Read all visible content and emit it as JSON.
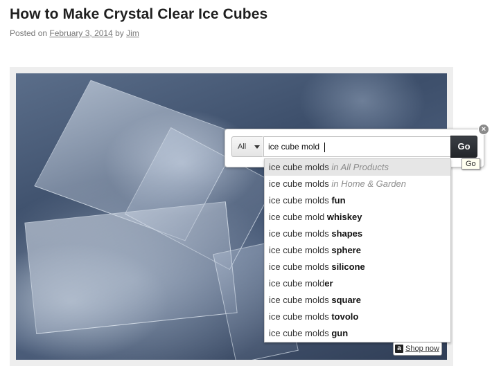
{
  "post": {
    "title": "How to Make Crystal Clear Ice Cubes",
    "posted_on_label": "Posted on",
    "date": "February 3, 2014",
    "by_label": "by",
    "author": "Jim"
  },
  "search": {
    "category": "All",
    "query": "ice cube mold",
    "go_label": "Go",
    "go_tooltip": "Go",
    "close_glyph": "×"
  },
  "suggestions": [
    {
      "prefix": "ice cube molds",
      "bold": "",
      "scope": "in All Products",
      "active": true
    },
    {
      "prefix": "ice cube molds",
      "bold": "",
      "scope": "in Home & Garden",
      "active": false
    },
    {
      "prefix": "ice cube molds",
      "bold": "fun",
      "scope": "",
      "active": false
    },
    {
      "prefix": "ice cube mold",
      "bold": "whiskey",
      "scope": "",
      "active": false
    },
    {
      "prefix": "ice cube molds",
      "bold": "shapes",
      "scope": "",
      "active": false
    },
    {
      "prefix": "ice cube molds",
      "bold": "sphere",
      "scope": "",
      "active": false
    },
    {
      "prefix": "ice cube molds",
      "bold": "silicone",
      "scope": "",
      "active": false
    },
    {
      "prefix": "ice cube mold",
      "bold": "er",
      "scope": "",
      "active": false,
      "attached": true
    },
    {
      "prefix": "ice cube molds",
      "bold": "square",
      "scope": "",
      "active": false
    },
    {
      "prefix": "ice cube molds",
      "bold": "tovolo",
      "scope": "",
      "active": false
    },
    {
      "prefix": "ice cube molds",
      "bold": "gun",
      "scope": "",
      "active": false
    }
  ],
  "shop_now": {
    "badge": "a",
    "label": "Shop now"
  }
}
